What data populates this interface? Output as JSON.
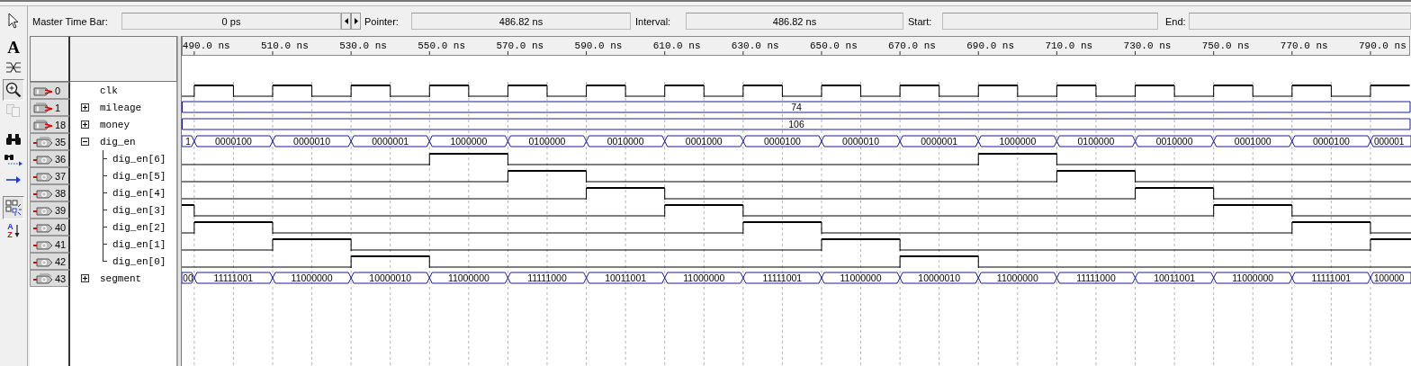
{
  "toolbar": {
    "master_label": "Master Time Bar:",
    "master_value": "0 ps",
    "pointer_label": "Pointer:",
    "pointer_value": "486.82 ns",
    "interval_label": "Interval:",
    "interval_value": "486.82 ns",
    "start_label": "Start:",
    "end_label": "End:"
  },
  "tools": [
    {
      "kind": "select",
      "pressed": false,
      "disabled": false
    },
    {
      "kind": "text",
      "glyph": "A",
      "pressed": false,
      "disabled": false
    },
    {
      "kind": "node",
      "pressed": false,
      "disabled": false
    },
    {
      "kind": "zoom",
      "pressed": true,
      "disabled": false
    },
    {
      "kind": "copy",
      "pressed": false,
      "disabled": true
    },
    {
      "kind": "find",
      "pressed": false,
      "disabled": false
    },
    {
      "kind": "find_next",
      "pressed": false,
      "disabled": false
    },
    {
      "kind": "goto",
      "pressed": false,
      "disabled": false
    },
    {
      "kind": "snap",
      "pressed": true,
      "disabled": false
    },
    {
      "kind": "sort",
      "top": "A",
      "bottom": "Z",
      "pressed": false,
      "disabled": false
    }
  ],
  "ruler": [
    "490.0 ns",
    "510.0 ns",
    "530.0 ns",
    "550.0 ns",
    "570.0 ns",
    "590.0 ns",
    "610.0 ns",
    "630.0 ns",
    "650.0 ns",
    "670.0 ns",
    "690.0 ns",
    "710.0 ns",
    "730.0 ns",
    "750.0 ns",
    "770.0 ns",
    "790.0 ns"
  ],
  "signals": [
    {
      "index": "0",
      "name": "clk",
      "output": false,
      "bus": false,
      "kind": "clock",
      "high": [
        false,
        true,
        false,
        true,
        false,
        true,
        false,
        true,
        false,
        true,
        false,
        true,
        false,
        true,
        false,
        true,
        false,
        true,
        false,
        true,
        false,
        true,
        false,
        true,
        false,
        true,
        false,
        true,
        false,
        true,
        false,
        true
      ]
    },
    {
      "index": "1",
      "name": "mileage",
      "output": false,
      "bus": true,
      "kind": "constant",
      "expanded": false,
      "value": "74"
    },
    {
      "index": "18",
      "name": "money",
      "output": false,
      "bus": true,
      "kind": "constant",
      "expanded": false,
      "value": "106"
    },
    {
      "index": "35",
      "name": "dig_en",
      "output": true,
      "bus": true,
      "kind": "bus",
      "expanded": true,
      "values": [
        "1",
        "0000100",
        "0000010",
        "0000001",
        "1000000",
        "0100000",
        "0010000",
        "0001000",
        "0000100",
        "0000010",
        "0000001",
        "1000000",
        "0100000",
        "0010000",
        "0001000",
        "0000100",
        "000001"
      ],
      "children": [
        {
          "index": "36",
          "name": "dig_en[6]",
          "output": true,
          "bus": false,
          "kind": "bit",
          "high": [
            false,
            false,
            false,
            false,
            true,
            false,
            false,
            false,
            false,
            false,
            false,
            true,
            false,
            false,
            false,
            false,
            false
          ]
        },
        {
          "index": "37",
          "name": "dig_en[5]",
          "output": true,
          "bus": false,
          "kind": "bit",
          "high": [
            false,
            false,
            false,
            false,
            false,
            true,
            false,
            false,
            false,
            false,
            false,
            false,
            true,
            false,
            false,
            false,
            false
          ]
        },
        {
          "index": "38",
          "name": "dig_en[4]",
          "output": true,
          "bus": false,
          "kind": "bit",
          "high": [
            false,
            false,
            false,
            false,
            false,
            false,
            true,
            false,
            false,
            false,
            false,
            false,
            false,
            true,
            false,
            false,
            false
          ]
        },
        {
          "index": "39",
          "name": "dig_en[3]",
          "output": true,
          "bus": false,
          "kind": "bit",
          "high": [
            true,
            false,
            false,
            false,
            false,
            false,
            false,
            true,
            false,
            false,
            false,
            false,
            false,
            false,
            true,
            false,
            false
          ]
        },
        {
          "index": "40",
          "name": "dig_en[2]",
          "output": true,
          "bus": false,
          "kind": "bit",
          "high": [
            false,
            true,
            false,
            false,
            false,
            false,
            false,
            false,
            true,
            false,
            false,
            false,
            false,
            false,
            false,
            true,
            false
          ]
        },
        {
          "index": "41",
          "name": "dig_en[1]",
          "output": true,
          "bus": false,
          "kind": "bit",
          "high": [
            false,
            false,
            true,
            false,
            false,
            false,
            false,
            false,
            false,
            true,
            false,
            false,
            false,
            false,
            false,
            false,
            true
          ]
        },
        {
          "index": "42",
          "name": "dig_en[0]",
          "output": true,
          "bus": false,
          "kind": "bit",
          "high": [
            false,
            false,
            false,
            true,
            false,
            false,
            false,
            false,
            false,
            false,
            true,
            false,
            false,
            false,
            false,
            false,
            false
          ]
        }
      ]
    },
    {
      "index": "43",
      "name": "segment",
      "output": true,
      "bus": true,
      "kind": "bus",
      "expanded": false,
      "values": [
        "00",
        "11111001",
        "11000000",
        "10000010",
        "11000000",
        "11111000",
        "10011001",
        "11000000",
        "11111001",
        "11000000",
        "10000010",
        "11000000",
        "11111000",
        "10011001",
        "11000000",
        "11111001",
        "100000"
      ]
    }
  ]
}
